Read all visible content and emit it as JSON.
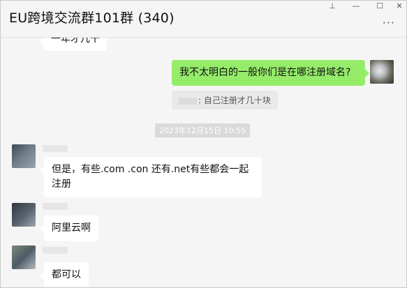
{
  "window": {
    "title": "EU跨境交流群101群 (340)",
    "controls": {
      "pin": "⊥",
      "minimize": "—",
      "maximize": "☐",
      "close": "✕"
    },
    "more": "···"
  },
  "messages": {
    "partial_top": {
      "text": "一年才几十"
    },
    "me_question": {
      "text": "我不太明白的一般你们是在哪注册域名?"
    },
    "quote": {
      "text": ": 自己注册才几十块"
    },
    "timestamp": {
      "text": "2023年12月15日 10:55"
    },
    "msg1": {
      "text": "但是，有些.com  .con 还有.net有些都会一起注册"
    },
    "msg2": {
      "text": "阿里云啊"
    },
    "msg3": {
      "text": "都可以"
    }
  }
}
